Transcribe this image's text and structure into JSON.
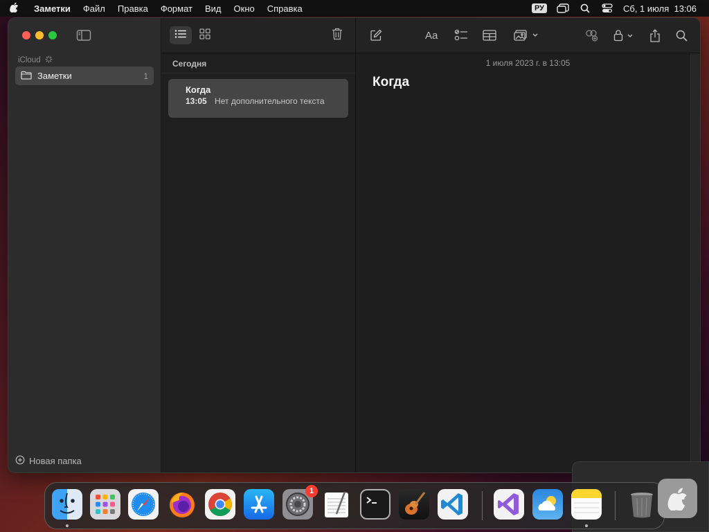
{
  "menubar": {
    "app_name": "Заметки",
    "items": [
      "Файл",
      "Правка",
      "Формат",
      "Вид",
      "Окно",
      "Справка"
    ],
    "keyboard_layout": "РУ",
    "clock": "Сб, 1 июля  13:06"
  },
  "sidebar": {
    "account_label": "iCloud",
    "folder": {
      "name": "Заметки",
      "count": "1"
    },
    "new_folder_label": "Новая папка"
  },
  "notes_list": {
    "section_title": "Сегодня",
    "note": {
      "title": "Когда",
      "time": "13:05",
      "preview": "Нет дополнительного текста"
    }
  },
  "editor": {
    "date_line": "1 июля 2023 г. в 13:05",
    "title": "Когда",
    "format_button_label": "Aa"
  },
  "dock": {
    "apps": [
      "finder",
      "launchpad",
      "safari",
      "firefox",
      "chrome",
      "app-store",
      "system-settings",
      "textedit",
      "terminal",
      "garageband",
      "vscode",
      "visual-studio",
      "weather",
      "notes",
      "trash"
    ],
    "settings_badge": "1"
  },
  "colors": {
    "close": "#ff5f57",
    "minimize": "#febc2e",
    "maximize": "#28c840",
    "badge": "#ff3b30"
  }
}
